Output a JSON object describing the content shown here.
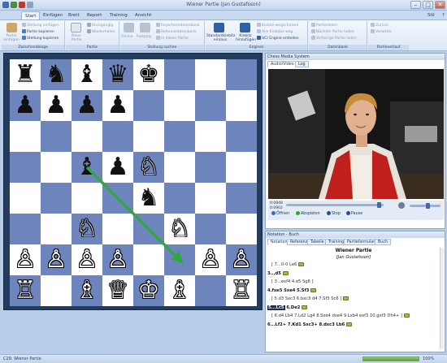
{
  "window": {
    "title": "Wiener Partie (Jan Gustafsson)",
    "minimize": "–",
    "maximize": "□",
    "close": "✕",
    "style_label": "Stil",
    "help_label": "?"
  },
  "tabs": [
    "Start",
    "Einfügen",
    "Brett",
    "Report",
    "Training",
    "Ansicht"
  ],
  "active_tab": "Start",
  "ribbon": {
    "clipboard": {
      "label": "Zwischenablage",
      "paste": "Partie einfügen",
      "items": [
        "Stellung einfügen",
        "Partie kopieren",
        "Stellung kopieren"
      ]
    },
    "partie": {
      "label": "Partie",
      "new": "Neue Partie",
      "items": [
        "Rückgängig",
        "Wiederholen"
      ]
    },
    "stellung": {
      "label": "Stellung suchen",
      "online": "Online",
      "fastplay": "Fastplay",
      "items": [
        "Repertoiredatenbank",
        "Referenzdatenbank",
        "In dieser Partie"
      ]
    },
    "engines": {
      "label": "Engines",
      "standard": "Standardkiebitz ein/aus",
      "kiebitz": "Kiebitz hinzufügen",
      "items": [
        "Kiebitz wegschicken",
        "Alle Kiebitze weg",
        "UCI Engine erstellen"
      ]
    },
    "datenbank": {
      "label": "Datenbank",
      "items": [
        "Partiedaten",
        "Nächste Partie laden",
        "Vorherige Partie laden"
      ]
    },
    "verlauf": {
      "label": "Partieverlauf",
      "items": [
        "Zurück",
        "Vorwärts"
      ]
    }
  },
  "board": {
    "ranks": [
      [
        "br",
        "bn",
        "bb",
        "bq",
        "bk",
        "",
        "",
        ""
      ],
      [
        "bp",
        "bp",
        "bp",
        "bp",
        "",
        "",
        "",
        ""
      ],
      [
        "",
        "",
        "",
        "",
        "",
        "",
        "",
        ""
      ],
      [
        "",
        "",
        "bb",
        "bp",
        "wn",
        "",
        "",
        ""
      ],
      [
        "",
        "",
        "",
        "",
        "bn",
        "",
        "",
        ""
      ],
      [
        "",
        "",
        "wn",
        "",
        "",
        "wn",
        "",
        ""
      ],
      [
        "wp",
        "wp",
        "wp",
        "wp",
        "",
        "",
        "wp",
        "wp"
      ],
      [
        "wr",
        "",
        "wb",
        "wq",
        "wk",
        "wb",
        "",
        "wr"
      ]
    ],
    "glyphs": {
      "wk": "♔",
      "wq": "♕",
      "wr": "♖",
      "wb": "♗",
      "wn": "♘",
      "wp": "♙",
      "bk": "♚",
      "bq": "♛",
      "br": "♜",
      "bb": "♝",
      "bn": "♞",
      "bp": "♟"
    },
    "arrow_color": "#2eaa3a",
    "arrow_from": "c5",
    "arrow_to": "f2"
  },
  "media": {
    "header": "Chess Media System",
    "tabs": [
      "Audio/Video",
      "Log"
    ],
    "time_elapsed": "0:0848",
    "time_total": "0:0902",
    "controls": [
      "Öffnen",
      "Abspielen",
      "Stop",
      "Pause"
    ]
  },
  "notation": {
    "header": "Notation - Buch",
    "tabs": [
      "Notation",
      "Referenz",
      "Tabelle",
      "Training",
      "Partieformular",
      "Buch"
    ],
    "game_title": "Wiener Partie",
    "game_author": "[Jan Gustafsson]",
    "lines": [
      {
        "kind": "var",
        "text": "[ 7...0-0  Le6"
      },
      {
        "kind": "mv",
        "text": "3...d5"
      },
      {
        "kind": "var",
        "text": "[ 3...exf4  4.e5  Sg8 ]"
      },
      {
        "kind": "mv",
        "text": "4.fxe5  Sxe4  5.Sf3"
      },
      {
        "kind": "var",
        "text": "[ 5.d3  Sxc3  6.bxc3  d4  7.Sf3  Sc6 ]"
      },
      {
        "kind": "mv-hl",
        "text": "5...Lc5",
        "rest": "  6.De2"
      },
      {
        "kind": "var",
        "text": "[ 6.d4  Lb4  7.Ld2  Lg4  8.Sxe4  dxe4  9.Lxb4  exf3  10.gxf3  Dh4+ ]"
      },
      {
        "kind": "mv",
        "text": "6...Lf2+  7.Kd1  Sxc3+  8.dxc3  Lb6"
      }
    ]
  },
  "status": {
    "text": "C29: Wiener Partie",
    "progress_percent": 100,
    "progress_label": "100%"
  }
}
